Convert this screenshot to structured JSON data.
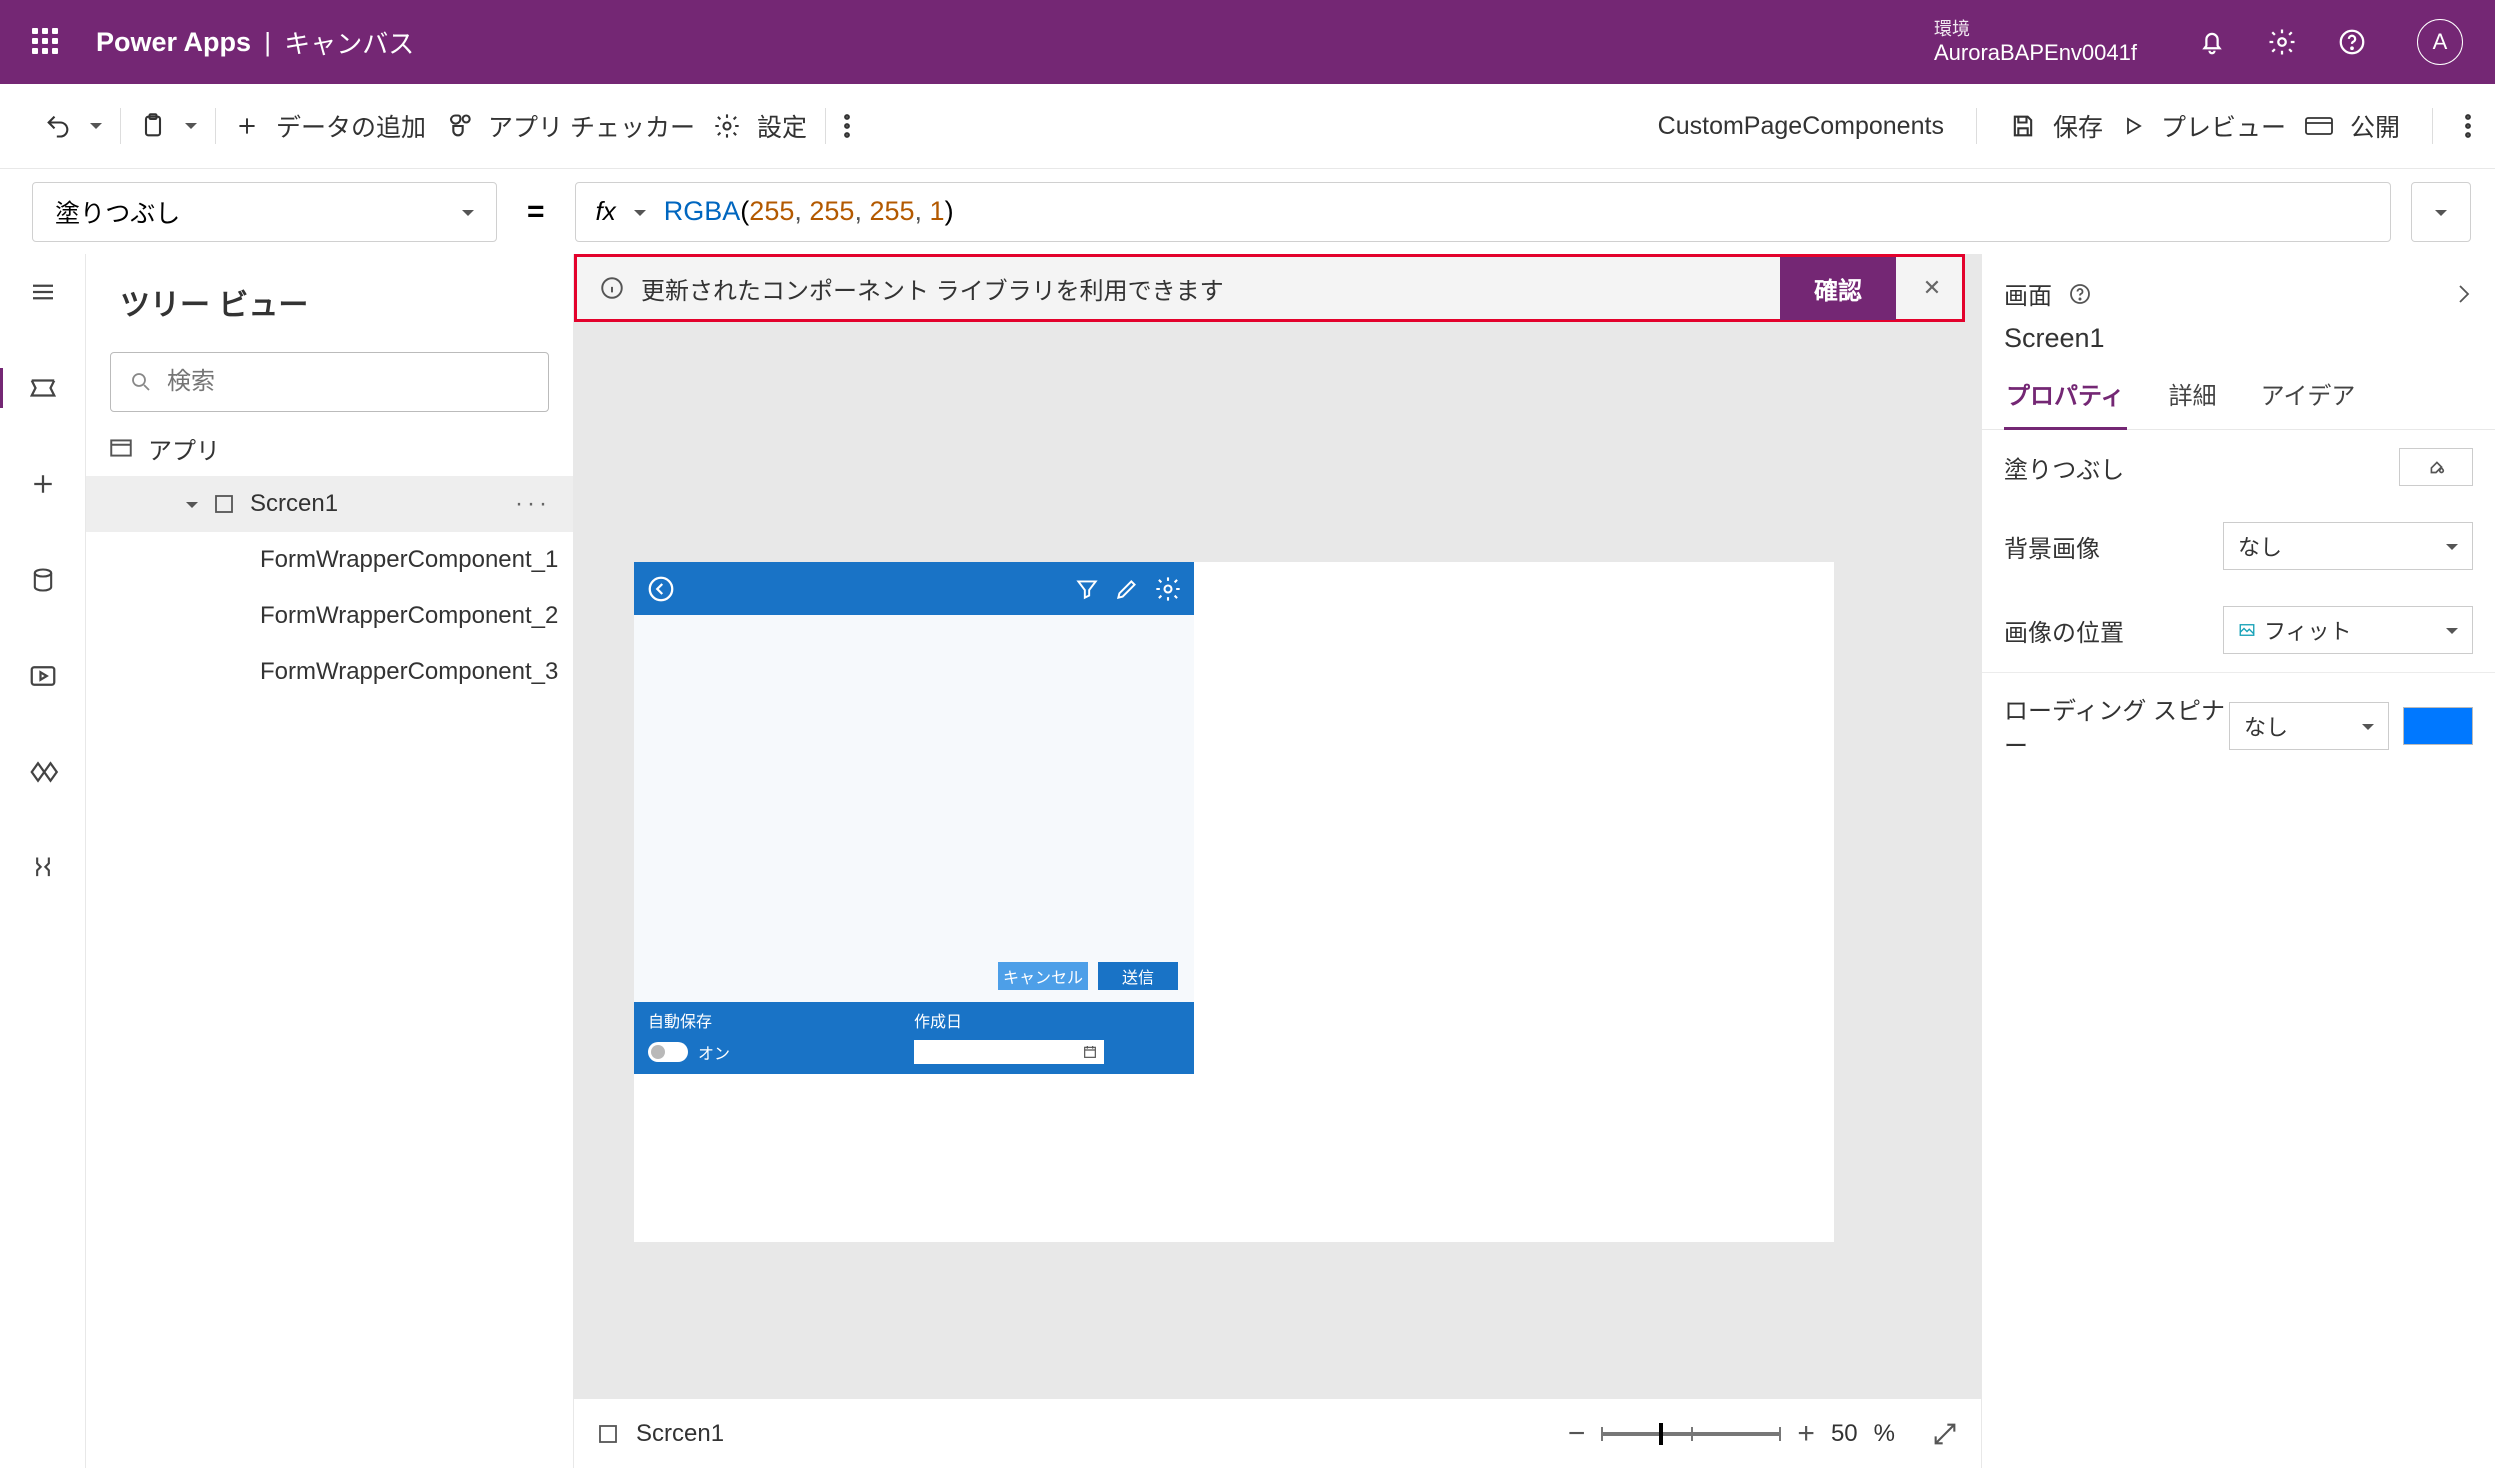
{
  "header": {
    "app": "Power Apps",
    "sub": "キャンバス",
    "env_label": "環境",
    "env_name": "AuroraBAPEnv0041f",
    "avatar_initial": "A"
  },
  "cmd": {
    "data_add": "データの追加",
    "app_checker": "アプリ チェッカー",
    "settings": "設定",
    "app_name": "CustomPageComponents",
    "save": "保存",
    "preview": "プレビュー",
    "publish": "公開"
  },
  "formula": {
    "prop": "塗りつぶし",
    "fx": "fx",
    "text": "RGBA(255, 255, 255, 1)",
    "tokens": {
      "fn": "RGBA",
      "l": "(",
      "n1": "255",
      "c": ", ",
      "n2": "255",
      "n3": "255",
      "n4": "1",
      "r": ")"
    }
  },
  "notif": {
    "msg": "更新されたコンポーネント ライブラリを利用できます",
    "btn": "確認"
  },
  "tree": {
    "title": "ツリー ビュー",
    "search_ph": "検索",
    "app_item": "アプリ",
    "screen": "Scrcen1",
    "c1": "FormWrapperComponent_1",
    "c2": "FormWrapperComponent_2",
    "c3": "FormWrapperComponent_3"
  },
  "canvas": {
    "btn_cancel": "キャンセル",
    "btn_send": "送信",
    "autosave_label": "自動保存",
    "autosave_state": "オン",
    "created_label": "作成日"
  },
  "status": {
    "screen": "Scrcen1",
    "zoom_val": "50",
    "zoom_pct": "%"
  },
  "props": {
    "kind": "画面",
    "name": "Screen1",
    "tabs": {
      "prop": "プロパティ",
      "detail": "詳細",
      "idea": "アイデア"
    },
    "fill": "塗りつぶし",
    "bg_image": "背景画像",
    "bg_image_val": "なし",
    "img_pos": "画像の位置",
    "img_pos_val": "フィット",
    "spinner": "ローディング スピナー",
    "spinner_val": "なし"
  }
}
